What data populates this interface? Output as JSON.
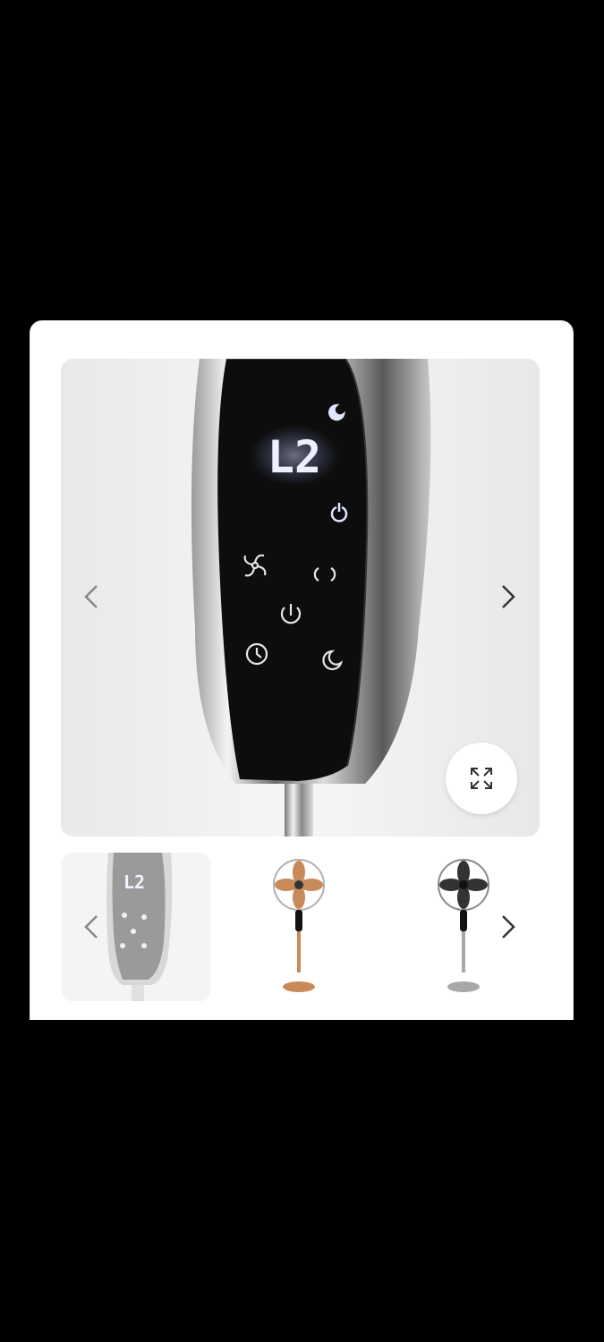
{
  "gallery": {
    "main_image": {
      "alt": "",
      "display_text": "L2"
    },
    "controls": {
      "prev_main": "prev-arrow",
      "next_main": "next-arrow",
      "expand": "expand-icon",
      "prev_thumbs": "prev-arrow",
      "next_thumbs": "next-arrow"
    },
    "thumbnails": [
      {
        "display_text": "L2",
        "selected": true
      },
      {
        "color": "#c98a5a",
        "selected": false
      },
      {
        "color": "#333333",
        "selected": false
      }
    ]
  }
}
